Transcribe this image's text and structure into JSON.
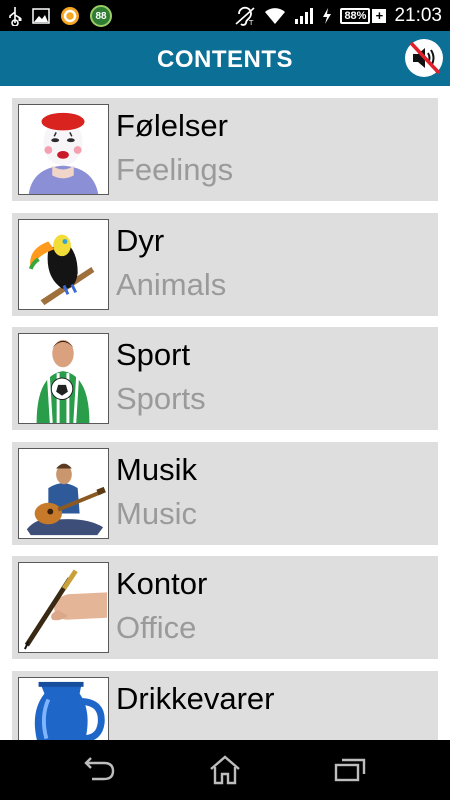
{
  "status_bar": {
    "time": "21:03",
    "battery": "88%",
    "notification_badge": "88",
    "icons": [
      "usb-icon",
      "image-icon",
      "app-notification-icon",
      "badge-88-icon",
      "hearing-aid-icon",
      "wifi-icon",
      "signal-icon",
      "charging-icon",
      "battery-icon"
    ]
  },
  "header": {
    "title": "CONTENTS",
    "sound_icon": "speaker-muted-icon"
  },
  "categories": [
    {
      "label_da": "Følelser",
      "label_en": "Feelings",
      "icon": "clown-face-image"
    },
    {
      "label_da": "Dyr",
      "label_en": "Animals",
      "icon": "toucan-image"
    },
    {
      "label_da": "Sport",
      "label_en": "Sports",
      "icon": "football-player-image"
    },
    {
      "label_da": "Musik",
      "label_en": "Music",
      "icon": "guitar-player-image"
    },
    {
      "label_da": "Kontor",
      "label_en": "Office",
      "icon": "hand-pen-image"
    },
    {
      "label_da": "Drikkevarer",
      "label_en": "",
      "icon": "blue-jug-image"
    }
  ],
  "nav": {
    "icons": [
      "back-icon",
      "home-icon",
      "recent-apps-icon"
    ]
  },
  "colors": {
    "header_bg": "#0b6f96",
    "item_bg": "#dedede",
    "secondary_text": "#9a9a9a"
  }
}
